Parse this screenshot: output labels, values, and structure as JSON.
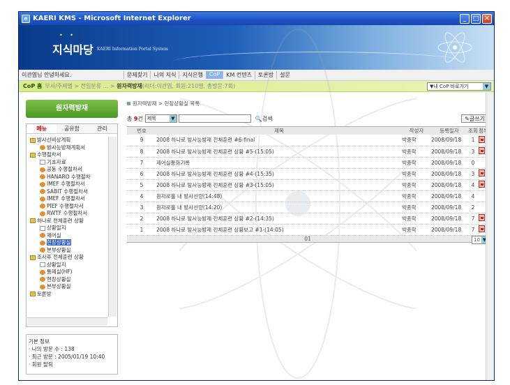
{
  "window": {
    "title": "KAERI KMS - Microsoft Internet Explorer",
    "minimize_label": "_",
    "maximize_label": "□",
    "close_label": "✕"
  },
  "banner": {
    "logo_text": "지식마당",
    "logo_subtitle": "KAERI Information Portal System"
  },
  "nav": {
    "greeting": "이관엽님 안녕하세요.",
    "tabs": [
      "문제찾기",
      "나의 지식",
      "지식은행",
      "CoP",
      "KM 컨텐츠",
      "토론방",
      "설문"
    ],
    "active_tab": "CoP"
  },
  "crumbbar": {
    "home": "CoP 홈",
    "path_prefix": "부서/주제별 > 전임분류 ... >",
    "path_current": "원자력방재",
    "path_suffix": "(리더:이관엽, 회원:210명, 총방문:7회)",
    "goto_label": "▼내 CoP 바로가기"
  },
  "left": {
    "cop_title": "원자력방재",
    "menu_tabs": [
      "메뉴",
      "공유함",
      "관리"
    ],
    "tree": [
      {
        "label": "방사선비상계획",
        "icon": "folder",
        "indent": 0
      },
      {
        "label": "방사능방재계획서",
        "icon": "gear",
        "indent": 1
      },
      {
        "label": "수행절차서",
        "icon": "folder",
        "indent": 0
      },
      {
        "label": "기초자료",
        "icon": "page",
        "indent": 1
      },
      {
        "label": "공동 수행절차서",
        "icon": "gear",
        "indent": 1
      },
      {
        "label": "HANARO 수행절차",
        "icon": "gear",
        "indent": 1
      },
      {
        "label": "IMEF 수행절차서",
        "icon": "gear",
        "indent": 1
      },
      {
        "label": "SABIT 수행절차서",
        "icon": "gear",
        "indent": 1
      },
      {
        "label": "IMEF 수행절차서",
        "icon": "gear",
        "indent": 1
      },
      {
        "label": "PIEF 수행절차서",
        "icon": "gear",
        "indent": 1
      },
      {
        "label": "RWTF 수행절차서",
        "icon": "gear",
        "indent": 1
      },
      {
        "label": "하나로 전체훈련 상황",
        "icon": "folder",
        "indent": 0
      },
      {
        "label": "상황일지",
        "icon": "page",
        "indent": 1
      },
      {
        "label": "제어실",
        "icon": "gear",
        "indent": 1
      },
      {
        "label": "현장상황실",
        "icon": "gear",
        "indent": 1,
        "selected": true
      },
      {
        "label": "본부상황실",
        "icon": "gear",
        "indent": 1
      },
      {
        "label": "조사후 전체훈련 상황",
        "icon": "folder",
        "indent": 0
      },
      {
        "label": "상황일지",
        "icon": "page",
        "indent": 1
      },
      {
        "label": "통제실(HF)",
        "icon": "gear",
        "indent": 1
      },
      {
        "label": "현장상황실",
        "icon": "gear",
        "indent": 1
      },
      {
        "label": "본부상황실",
        "icon": "gear",
        "indent": 1
      },
      {
        "label": "토론방",
        "icon": "folder",
        "indent": 0
      }
    ],
    "login_info": {
      "title": "기본 정보",
      "visits": "· 나의 방문 수 : 138",
      "recent": "· 최근 방문 : 2005/01/19 10:40",
      "withdraw": "· 회원 탈퇴"
    }
  },
  "board": {
    "crumb": "원자력방재 > 현장상황실 목록",
    "total_label": "총",
    "total_count": "9",
    "total_unit": "건",
    "search_field": "제목",
    "search_button": "검색",
    "write_button": "글쓰기",
    "columns": [
      "번호",
      "제목",
      "작성자",
      "등록일자",
      "조회",
      "첨부"
    ],
    "rows": [
      {
        "num": "9",
        "title": "2008 하나로 방사능방재 전체훈련 #6-final",
        "author": "박종학",
        "date": "2008/09/18",
        "views": "1",
        "attach": true
      },
      {
        "num": "8",
        "title": "2008 하나로 방사능방재 전체훈련 상황 #5-(15:05)",
        "author": "박종학",
        "date": "2008/09/18",
        "views": "3",
        "attach": true
      },
      {
        "num": "7",
        "title": "제어실통화기록",
        "author": "박종학",
        "date": "2008/09/18",
        "views": "0",
        "attach": false
      },
      {
        "num": "6",
        "title": "2008 하나로 방사능방재 전체훈련 상황 #4-(15:35)",
        "author": "박종학",
        "date": "2008/09/18",
        "views": "3",
        "attach": true
      },
      {
        "num": "5",
        "title": "2008 하나로 방사능방재 전체훈련 상황 #3-(15:05)",
        "author": "박종학",
        "date": "2008/09/18",
        "views": "4",
        "attach": true
      },
      {
        "num": "4",
        "title": "원자로홀 내 방사선량(14:48)",
        "author": "박종학",
        "date": "2008/09/18",
        "views": "4",
        "attach": false
      },
      {
        "num": "3",
        "title": "원자로홀 내 방사선량(14:20)",
        "author": "박종학",
        "date": "2008/09/18",
        "views": "2",
        "attach": false
      },
      {
        "num": "2",
        "title": "2008 하나로 방사능방재 전체훈련 상황 #2-(14:35)",
        "author": "박종학",
        "date": "2008/09/18",
        "views": "7",
        "attach": true
      },
      {
        "num": "1",
        "title": "2008 하나로 방사능방재 전체훈련 상황보고 #1-(14:05)",
        "author": "박종학",
        "date": "2008/09/18",
        "views": "7",
        "attach": true
      }
    ],
    "page_label": "01",
    "page_size": "10"
  }
}
